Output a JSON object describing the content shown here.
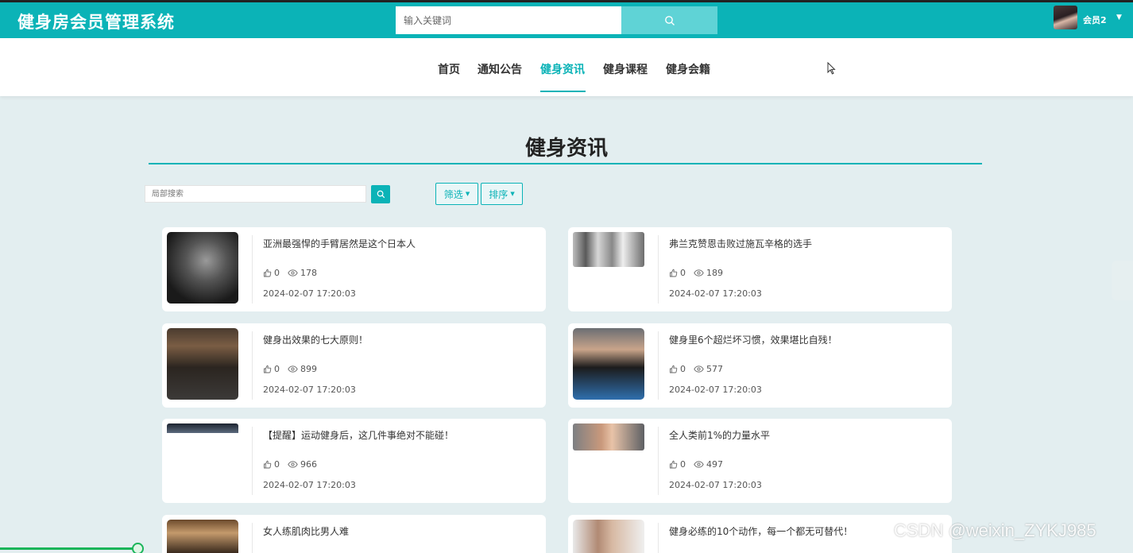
{
  "header": {
    "app_title": "健身房会员管理系统",
    "search_placeholder": "输入关键词",
    "username": "会员2",
    "brand_color": "#0bb3b7"
  },
  "nav": {
    "items": [
      {
        "label": "首页",
        "active": false
      },
      {
        "label": "通知公告",
        "active": false
      },
      {
        "label": "健身资讯",
        "active": true
      },
      {
        "label": "健身课程",
        "active": false
      },
      {
        "label": "健身会籍",
        "active": false
      }
    ]
  },
  "main": {
    "section_title": "健身资讯",
    "local_search_placeholder": "局部搜索",
    "filter_label": "筛选",
    "sort_label": "排序"
  },
  "articles": [
    {
      "title": "亚洲最强悍的手臂居然是这个日本人",
      "likes": "0",
      "views": "178",
      "date": "2024-02-07 17:20:03"
    },
    {
      "title": "弗兰克赞恩击败过施瓦辛格的选手",
      "likes": "0",
      "views": "189",
      "date": "2024-02-07 17:20:03"
    },
    {
      "title": "健身出效果的七大原则！",
      "likes": "0",
      "views": "899",
      "date": "2024-02-07 17:20:03"
    },
    {
      "title": "健身里6个超烂坏习惯，效果堪比自残！",
      "likes": "0",
      "views": "577",
      "date": "2024-02-07 17:20:03"
    },
    {
      "title": "【提醒】运动健身后，这几件事绝对不能碰！",
      "likes": "0",
      "views": "966",
      "date": "2024-02-07 17:20:03"
    },
    {
      "title": "全人类前1%的力量水平",
      "likes": "0",
      "views": "497",
      "date": "2024-02-07 17:20:03"
    },
    {
      "title": "女人练肌肉比男人难",
      "likes": "",
      "views": "",
      "date": ""
    },
    {
      "title": "健身必练的10个动作，每一个都无可替代！",
      "likes": "",
      "views": "",
      "date": ""
    }
  ],
  "watermark": "CSDN @weixin_ZYKJ985"
}
